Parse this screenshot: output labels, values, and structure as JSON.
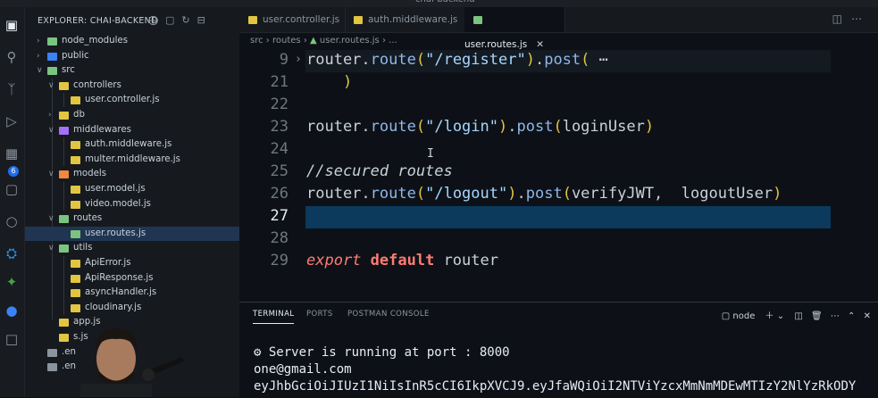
{
  "window": {
    "title": "chai-backend"
  },
  "explorer": {
    "title": "EXPLORER: CHAI-BACKEND",
    "tree": [
      {
        "label": "node_modules",
        "kind": "folder",
        "state": "closed",
        "depth": 1,
        "color": "#7bc47f"
      },
      {
        "label": "public",
        "kind": "folder",
        "state": "closed",
        "depth": 1,
        "color": "#3b82f6"
      },
      {
        "label": "src",
        "kind": "folder",
        "state": "open",
        "depth": 1,
        "color": "#7bc47f"
      },
      {
        "label": "controllers",
        "kind": "folder",
        "state": "open",
        "depth": 2,
        "color": "#e2c541"
      },
      {
        "label": "user.controller.js",
        "kind": "file",
        "depth": 3,
        "color": "#e2c541"
      },
      {
        "label": "db",
        "kind": "folder",
        "state": "closed",
        "depth": 2,
        "color": "#e2c541"
      },
      {
        "label": "middlewares",
        "kind": "folder",
        "state": "open",
        "depth": 2,
        "color": "#a371f7"
      },
      {
        "label": "auth.middleware.js",
        "kind": "file",
        "depth": 3,
        "color": "#e2c541"
      },
      {
        "label": "multer.middleware.js",
        "kind": "file",
        "depth": 3,
        "color": "#e2c541"
      },
      {
        "label": "models",
        "kind": "folder",
        "state": "open",
        "depth": 2,
        "color": "#f0883e"
      },
      {
        "label": "user.model.js",
        "kind": "file",
        "depth": 3,
        "color": "#e2c541"
      },
      {
        "label": "video.model.js",
        "kind": "file",
        "depth": 3,
        "color": "#e2c541"
      },
      {
        "label": "routes",
        "kind": "folder",
        "state": "open",
        "depth": 2,
        "color": "#7bc47f"
      },
      {
        "label": "user.routes.js",
        "kind": "file",
        "depth": 3,
        "color": "#7bc47f",
        "selected": true
      },
      {
        "label": "utils",
        "kind": "folder",
        "state": "open",
        "depth": 2,
        "color": "#7bc47f"
      },
      {
        "label": "ApiError.js",
        "kind": "file",
        "depth": 3,
        "color": "#e2c541"
      },
      {
        "label": "ApiResponse.js",
        "kind": "file",
        "depth": 3,
        "color": "#e2c541"
      },
      {
        "label": "asyncHandler.js",
        "kind": "file",
        "depth": 3,
        "color": "#e2c541"
      },
      {
        "label": "cloudinary.js",
        "kind": "file",
        "depth": 3,
        "color": "#e2c541"
      },
      {
        "label": "app.js",
        "kind": "file",
        "depth": 2,
        "color": "#e2c541"
      },
      {
        "label": "s.js",
        "kind": "file",
        "depth": 2,
        "color": "#e2c541"
      },
      {
        "label": ".en",
        "kind": "file",
        "depth": 1,
        "color": "#8b949e"
      },
      {
        "label": ".en",
        "kind": "file",
        "depth": 1,
        "color": "#8b949e"
      }
    ]
  },
  "tabs": [
    {
      "label": "user.controller.js",
      "active": false
    },
    {
      "label": "auth.middleware.js",
      "active": false
    },
    {
      "label": "user.routes.js",
      "active": true
    }
  ],
  "breadcrumb": {
    "a": "src",
    "b": "routes",
    "c": "user.routes.js",
    "d": "..."
  },
  "editor": {
    "lines": [
      {
        "num": "9",
        "tokens": [
          [
            "router",
            "#c9d1d9"
          ],
          [
            ".",
            "#c9d1d9"
          ],
          [
            "route",
            "#8fb8e8"
          ],
          [
            "(",
            "#e2c541"
          ],
          [
            "\"/register\"",
            "#a5d6ff"
          ],
          [
            ")",
            "#e2c541"
          ],
          [
            ".",
            "#c9d1d9"
          ],
          [
            "post",
            "#8fb8e8"
          ],
          [
            "(",
            "#e2c541"
          ],
          [
            " ⋯",
            "#c9d1d9"
          ]
        ],
        "sticky": true,
        "chev": true
      },
      {
        "num": "21",
        "tokens": [
          [
            "    )",
            "#e2c541"
          ]
        ]
      },
      {
        "num": "22",
        "tokens": []
      },
      {
        "num": "23",
        "tokens": [
          [
            "router",
            "#c9d1d9"
          ],
          [
            ".",
            "#c9d1d9"
          ],
          [
            "route",
            "#8fb8e8"
          ],
          [
            "(",
            "#e2c541"
          ],
          [
            "\"/login\"",
            "#a5d6ff"
          ],
          [
            ")",
            "#e2c541"
          ],
          [
            ".",
            "#c9d1d9"
          ],
          [
            "post",
            "#8fb8e8"
          ],
          [
            "(",
            "#e2c541"
          ],
          [
            "loginUser",
            "#c9d1d9"
          ],
          [
            ")",
            "#e2c541"
          ]
        ]
      },
      {
        "num": "24",
        "tokens": []
      },
      {
        "num": "25",
        "tokens": [
          [
            "//secured routes",
            "#c9d1d9"
          ]
        ],
        "italic": true
      },
      {
        "num": "26",
        "tokens": [
          [
            "router",
            "#c9d1d9"
          ],
          [
            ".",
            "#c9d1d9"
          ],
          [
            "route",
            "#8fb8e8"
          ],
          [
            "(",
            "#e2c541"
          ],
          [
            "\"/logout\"",
            "#a5d6ff"
          ],
          [
            ")",
            "#e2c541"
          ],
          [
            ".",
            "#c9d1d9"
          ],
          [
            "post",
            "#8fb8e8"
          ],
          [
            "(",
            "#e2c541"
          ],
          [
            "verifyJWT,  logoutUser",
            "#c9d1d9"
          ],
          [
            ")",
            "#e2c541"
          ]
        ]
      },
      {
        "num": "27",
        "tokens": [],
        "current": true
      },
      {
        "num": "28",
        "tokens": []
      },
      {
        "num": "29",
        "tokens": [
          [
            "export",
            "#ff7b72"
          ],
          [
            " ",
            "#c9d1d9"
          ],
          [
            "default",
            "#ff7b72"
          ],
          [
            " router",
            "#c9d1d9"
          ]
        ],
        "italic_first": true
      }
    ]
  },
  "panel": {
    "tabs": [
      {
        "label": "TERMINAL",
        "active": true
      },
      {
        "label": "PORTS",
        "active": false
      },
      {
        "label": "POSTMAN CONSOLE",
        "active": false
      }
    ],
    "shell": "node",
    "terminal_lines": [
      "⚙︎ Server is running at port : 8000",
      "one@gmail.com",
      "eyJhbGciOiJIUzI1NiIsInR5cCI6IkpXVCJ9.eyJfaWQiOiI2NTViYzcxMmNmMDEwMTIzY2NlYzRkODY"
    ]
  }
}
